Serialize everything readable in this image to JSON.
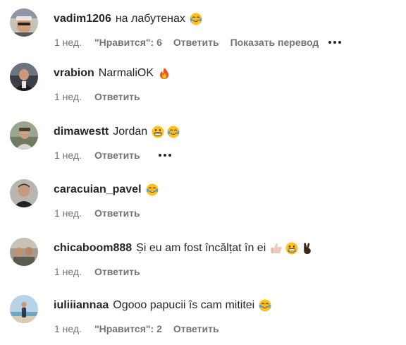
{
  "comments": [
    {
      "username": "vadim1206",
      "text": "на лабутенах",
      "time": "1 нед.",
      "likes": "\"Нравится\": 6",
      "reply": "Ответить",
      "translate": "Показать перевод"
    },
    {
      "username": "vrabion",
      "text": "NarmaliOK",
      "time": "1 нед.",
      "reply": "Ответить"
    },
    {
      "username": "dimawestt",
      "text": "Jordan",
      "time": "1 нед.",
      "reply": "Ответить"
    },
    {
      "username": "caracuian_pavel",
      "text": "",
      "time": "1 нед.",
      "reply": "Ответить"
    },
    {
      "username": "chicaboom888",
      "text": "Și eu am fost încălțat în ei",
      "time": "1 нед.",
      "reply": "Ответить"
    },
    {
      "username": "iuliiiannaa",
      "text": "Ogooo papucii îs cam mititei",
      "time": "1 нед.",
      "likes": "\"Нравится\": 2",
      "reply": "Ответить"
    }
  ],
  "icons": {
    "more": "more-options-icon",
    "laughing": "tears-of-joy-emoji",
    "fire": "fire-emoji",
    "grin": "grinning-emoji",
    "thumbs": "thumbs-up-emoji",
    "peace": "victory-hand-emoji"
  },
  "colors": {
    "text": "#262626",
    "meta": "#737373",
    "background": "#ffffff"
  }
}
